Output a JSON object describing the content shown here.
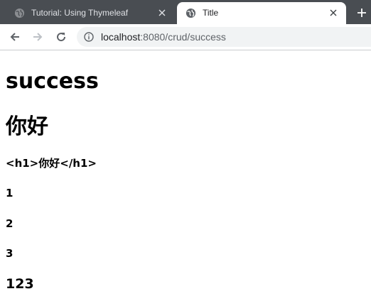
{
  "browser": {
    "tabs": [
      {
        "title": "Tutorial: Using Thymeleaf",
        "active": false,
        "favicon": "globe-icon"
      },
      {
        "title": "Title",
        "active": true,
        "favicon": "globe-icon"
      }
    ],
    "new_tab_icon": "plus-icon",
    "close_icon": "close-icon",
    "nav": {
      "back_icon": "arrow-left-icon",
      "forward_icon": "arrow-right-icon",
      "reload_icon": "reload-icon"
    },
    "address": {
      "host": "localhost",
      "rest": ":8080/crud/success",
      "info_icon": "info-icon"
    }
  },
  "page": {
    "heading": "success",
    "greeting": "你好",
    "escaped_text": "<h1>你好</h1>",
    "items": [
      "1",
      "2",
      "3"
    ],
    "joined": "123"
  },
  "colors": {
    "tabstrip": "#494d52",
    "omnibox": "#f1f3f4",
    "text_dark": "#202124",
    "url_muted": "#5f6368"
  }
}
